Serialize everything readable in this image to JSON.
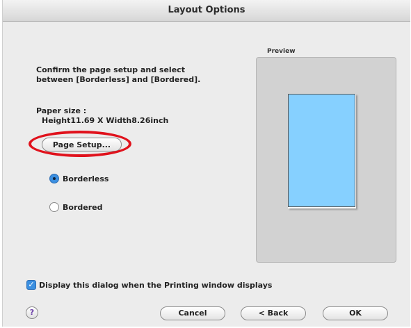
{
  "window": {
    "title": "Layout Options"
  },
  "content": {
    "instructions_line1": "Confirm the page setup and select",
    "instructions_line2": "between [Borderless] and [Bordered].",
    "paper_size_label": "Paper size :",
    "paper_size_value": "Height11.69 X Width8.26inch",
    "page_setup_label": "Page Setup..."
  },
  "layout": {
    "options": [
      {
        "label": "Borderless",
        "selected": true
      },
      {
        "label": "Bordered",
        "selected": false
      }
    ]
  },
  "preview": {
    "label": "Preview",
    "paper_color": "#86d0ff"
  },
  "footer": {
    "display_dialog_label": "Display this dialog when the Printing window displays",
    "display_dialog_checked": true,
    "help_label": "?",
    "cancel_label": "Cancel",
    "back_label": "< Back",
    "ok_label": "OK"
  },
  "colors": {
    "highlight": "#e0121c",
    "accent": "#3b8fe0"
  }
}
